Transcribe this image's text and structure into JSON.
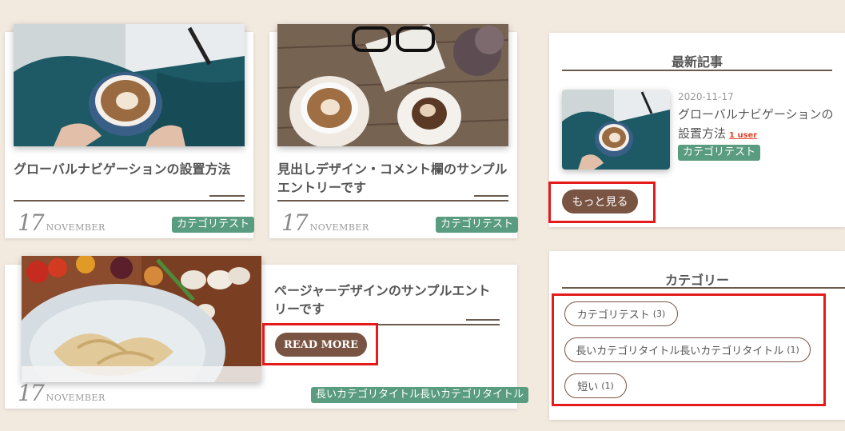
{
  "posts": [
    {
      "title": "グローバルナビゲーションの設置方法",
      "day": "17",
      "month": "NOVEMBER",
      "category": "カテゴリテスト"
    },
    {
      "title": "見出しデザイン・コメント欄のサンプルエントリーです",
      "day": "17",
      "month": "NOVEMBER",
      "category": "カテゴリテスト"
    },
    {
      "title": "ページャーデザインのサンプルエントリーです",
      "day": "17",
      "month": "NOVEMBER",
      "category": "長いカテゴリタイトル長いカテゴリタイトル",
      "read_more": "READ MORE"
    }
  ],
  "recent_widget": {
    "title": "最新記事",
    "item": {
      "date": "2020-11-17",
      "title": "グローバルナビゲーションの設置方法",
      "users": "1 user",
      "category": "カテゴリテスト"
    },
    "more_label": "もっと見る"
  },
  "category_widget": {
    "title": "カテゴリー",
    "tags": [
      {
        "label": "カテゴリテスト",
        "count": "(3)"
      },
      {
        "label": "長いカテゴリタイトル長いカテゴリタイトル",
        "count": "(1)"
      },
      {
        "label": "短い",
        "count": "(1)"
      }
    ]
  },
  "colors": {
    "background": "#f2e9df",
    "accent_brown": "#7a5442",
    "category_green": "#5a9c7f",
    "highlight_red": "#e31b1b"
  }
}
